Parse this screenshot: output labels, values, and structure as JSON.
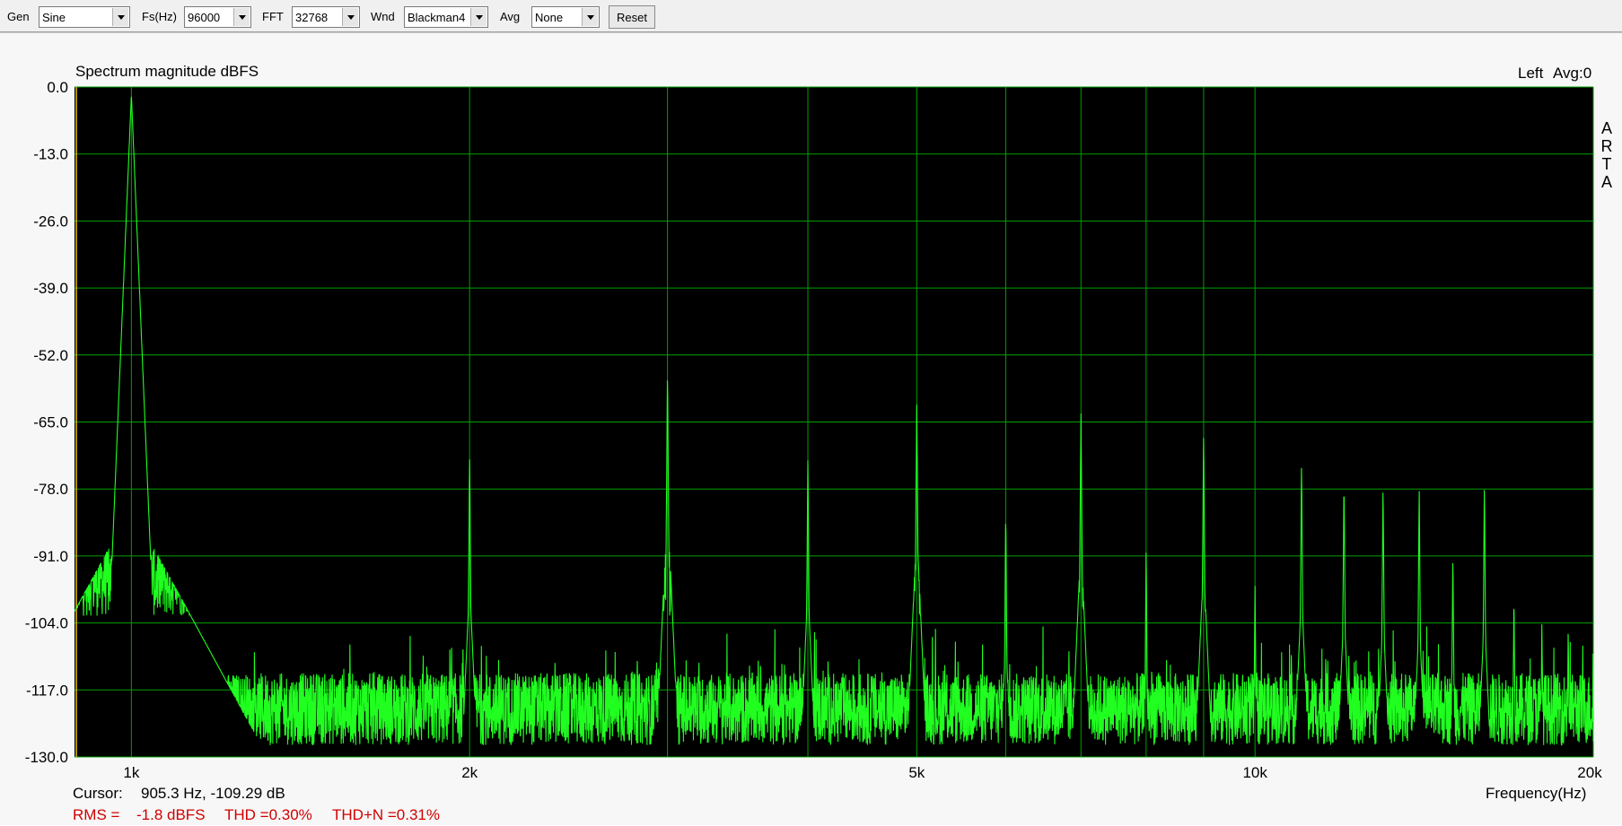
{
  "toolbar": {
    "gen_label": "Gen",
    "gen_value": "Sine",
    "fs_label": "Fs(Hz)",
    "fs_value": "96000",
    "fft_label": "FFT",
    "fft_value": "32768",
    "wnd_label": "Wnd",
    "wnd_value": "Blackman4",
    "avg_label": "Avg",
    "avg_value": "None",
    "reset_label": "Reset"
  },
  "plot": {
    "channel": "Left",
    "avg_status": "Avg:0",
    "side_logo": [
      "A",
      "R",
      "T",
      "A"
    ],
    "cursor_label": "Cursor:",
    "cursor_value": "905.3 Hz, -109.29 dB",
    "rms_label": "RMS =",
    "rms_value": "-1.8 dBFS",
    "thd": "THD =0.30%",
    "thdn": "THD+N =0.31%"
  },
  "colors": {
    "plot_bg": "#000000",
    "grid": "#00a000",
    "trace": "#20ff20",
    "stats": "#d00000"
  },
  "chart_data": {
    "type": "line",
    "title": "Spectrum magnitude dBFS",
    "xlabel": "Frequency(Hz)",
    "ylabel": "",
    "x_scale": "log",
    "xlim": [
      890,
      20000
    ],
    "ylim": [
      -130,
      0
    ],
    "y_ticks": [
      0,
      -13,
      -26,
      -39,
      -52,
      -65,
      -78,
      -91,
      -104,
      -117,
      -130
    ],
    "y_tick_labels": [
      "0.0",
      "-13.0",
      "-26.0",
      "-39.0",
      "-52.0",
      "-65.0",
      "-78.0",
      "-91.0",
      "-104.0",
      "-117.0",
      "-130.0"
    ],
    "x_labeled_ticks": [
      1000,
      2000,
      5000,
      10000,
      20000
    ],
    "x_tick_labels": [
      "1k",
      "2k",
      "5k",
      "10k",
      "20k"
    ],
    "x_grid": [
      1000,
      2000,
      3000,
      4000,
      5000,
      6000,
      7000,
      8000,
      9000,
      10000,
      20000
    ],
    "grid": true,
    "noise_floor_db": -120,
    "series": [
      {
        "x": [
          1000,
          2000,
          3000,
          4000,
          5000,
          6000,
          7000,
          8000,
          9000,
          10000,
          11000,
          12000,
          13000,
          14000,
          15000,
          16000,
          17000,
          18000,
          19000
        ],
        "y": [
          -1.5,
          -71,
          -55,
          -72,
          -60,
          -82,
          -63,
          -90,
          -67,
          -96,
          -73,
          -76,
          -77,
          -78,
          -90,
          -77,
          -98,
          -104,
          -104
        ]
      }
    ]
  }
}
